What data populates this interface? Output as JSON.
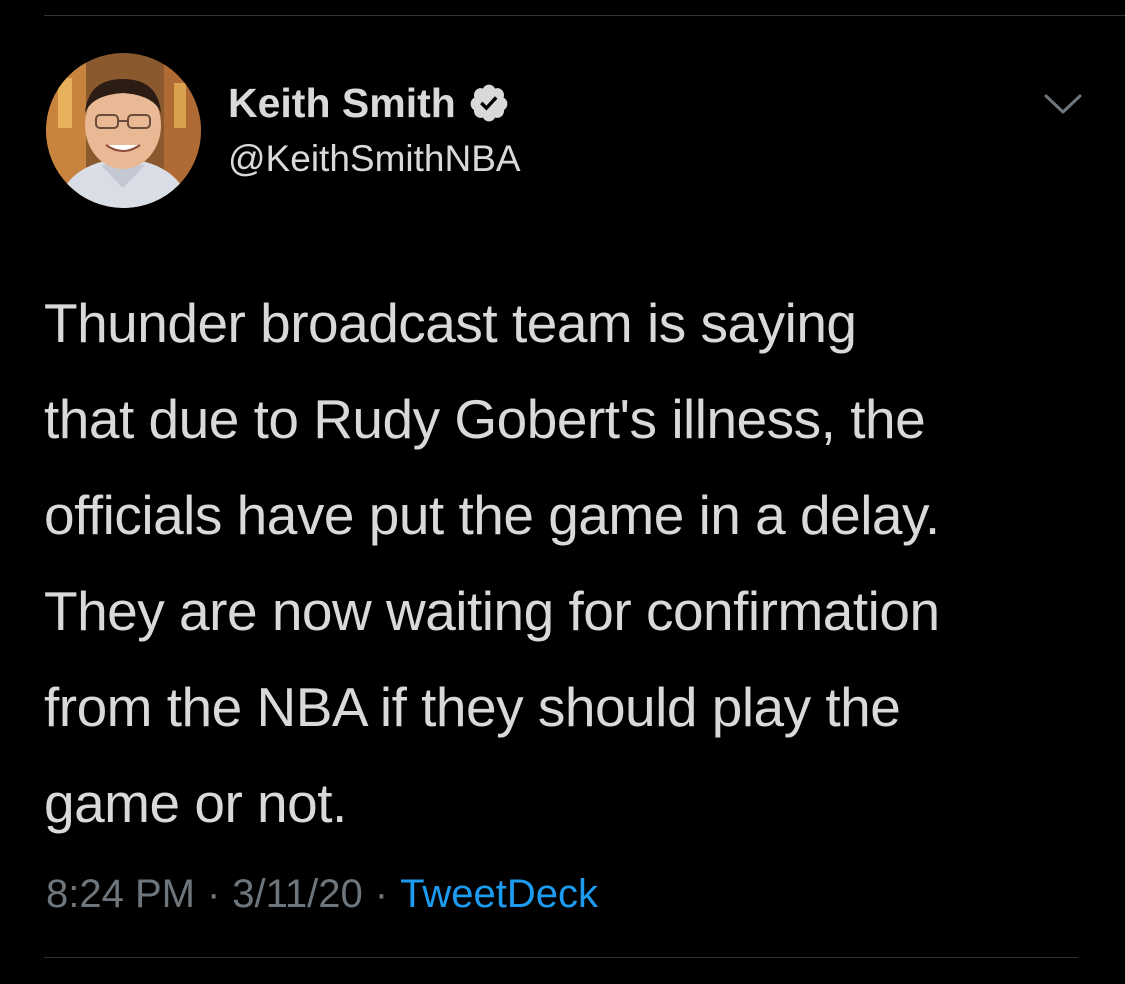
{
  "tweet": {
    "author": {
      "display_name": "Keith Smith",
      "handle": "@KeithSmithNBA",
      "verified": true,
      "avatar_icon": "user-avatar"
    },
    "text_lines": [
      "Thunder broadcast team is saying",
      "that due to Rudy Gobert's illness, the",
      "officials have put the game in a delay.",
      "They are now waiting for confirmation",
      "from the NBA if they should play the",
      "game or not."
    ],
    "meta": {
      "time": "8:24 PM",
      "separator": "·",
      "date": "3/11/20",
      "source": "TweetDeck"
    },
    "menu_icon": "chevron-down-icon"
  },
  "colors": {
    "background": "#000000",
    "text": "#d9d9d9",
    "secondary": "#6e767d",
    "link": "#1d9bf0",
    "divider": "#2f3336"
  }
}
